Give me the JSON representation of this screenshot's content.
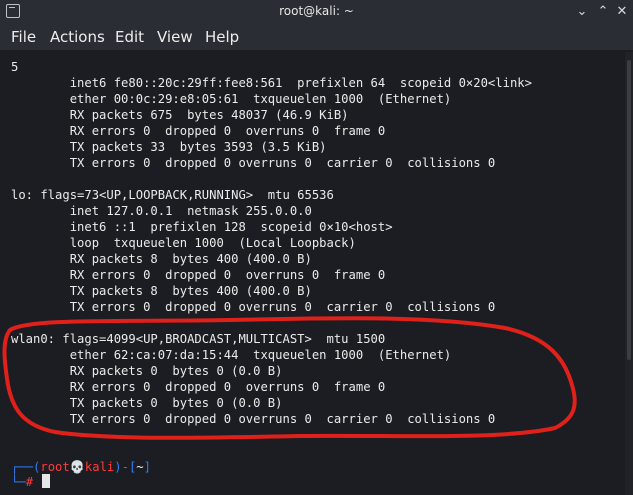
{
  "window": {
    "title": "root@kali: ~",
    "minimize": "⌄",
    "maximize": "⌃",
    "close": "✕"
  },
  "menu": {
    "items": [
      "File",
      "Actions",
      "Edit",
      "View",
      "Help"
    ]
  },
  "terminal": {
    "lines": [
      "5",
      "        inet6 fe80::20c:29ff:fee8:561  prefixlen 64  scopeid 0×20<link>",
      "        ether 00:0c:29:e8:05:61  txqueuelen 1000  (Ethernet)",
      "        RX packets 675  bytes 48037 (46.9 KiB)",
      "        RX errors 0  dropped 0  overruns 0  frame 0",
      "        TX packets 33  bytes 3593 (3.5 KiB)",
      "        TX errors 0  dropped 0 overruns 0  carrier 0  collisions 0",
      "",
      "lo: flags=73<UP,LOOPBACK,RUNNING>  mtu 65536",
      "        inet 127.0.0.1  netmask 255.0.0.0",
      "        inet6 ::1  prefixlen 128  scopeid 0×10<host>",
      "        loop  txqueuelen 1000  (Local Loopback)",
      "        RX packets 8  bytes 400 (400.0 B)",
      "        RX errors 0  dropped 0  overruns 0  frame 0",
      "        TX packets 8  bytes 400 (400.0 B)",
      "        TX errors 0  dropped 0 overruns 0  carrier 0  collisions 0",
      "",
      "wlan0: flags=4099<UP,BROADCAST,MULTICAST>  mtu 1500",
      "        ether 62:ca:07:da:15:44  txqueuelen 1000  (Ethernet)",
      "        RX packets 0  bytes 0 (0.0 B)",
      "        RX errors 0  dropped 0  overruns 0  frame 0",
      "        TX packets 0  bytes 0 (0.0 B)",
      "        TX errors 0  dropped 0 overruns 0  carrier 0  collisions 0"
    ],
    "prompt": {
      "open": "┌──(",
      "user": "root",
      "skull": "💀",
      "host": "kali",
      "mid": ")-[",
      "dir": "~",
      "close": "]",
      "line2": "└─",
      "symbol": "#"
    }
  },
  "colors": {
    "prompt_frame": "#2f7df6",
    "prompt_user": "#ff3b3b",
    "annotation": "#e0201a"
  },
  "icons": [
    "terminal-app-icon",
    "skull-icon"
  ]
}
